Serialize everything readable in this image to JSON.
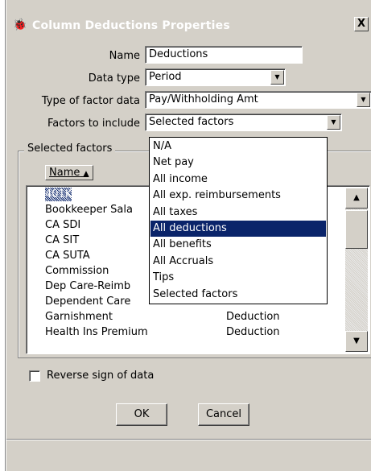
{
  "window": {
    "title": "Column Deductions Properties",
    "close_label": "X"
  },
  "form": {
    "name_label": "Name",
    "name_value": "Deductions",
    "data_type_label": "Data type",
    "data_type_value": "Period",
    "factor_type_label": "Type of factor data",
    "factor_type_value": "Pay/Withholding Amt",
    "factors_include_label": "Factors to include",
    "factors_include_value": "Selected factors"
  },
  "group": {
    "title": "Selected factors",
    "column_header": "Name"
  },
  "list_rows": [
    {
      "name": "401K",
      "type": ""
    },
    {
      "name": "Bookkeeper Sala",
      "type": ""
    },
    {
      "name": "CA SDI",
      "type": ""
    },
    {
      "name": "CA SIT",
      "type": ""
    },
    {
      "name": "CA SUTA",
      "type": ""
    },
    {
      "name": "Commission",
      "type": ""
    },
    {
      "name": "Dep Care-Reimb",
      "type": ""
    },
    {
      "name": "Dependent Care",
      "type": ""
    },
    {
      "name": "Garnishment",
      "type": "Deduction"
    },
    {
      "name": "Health Ins Premium",
      "type": "Deduction"
    }
  ],
  "dropdown_options": [
    "N/A",
    "Net pay",
    "All income",
    "All exp. reimbursements",
    "All taxes",
    "All deductions",
    "All benefits",
    "All Accruals",
    "Tips",
    "Selected factors"
  ],
  "selected_option_index": 5,
  "checkbox": {
    "label": "Reverse sign of data",
    "checked": false
  },
  "buttons": {
    "ok": "OK",
    "cancel": "Cancel"
  }
}
